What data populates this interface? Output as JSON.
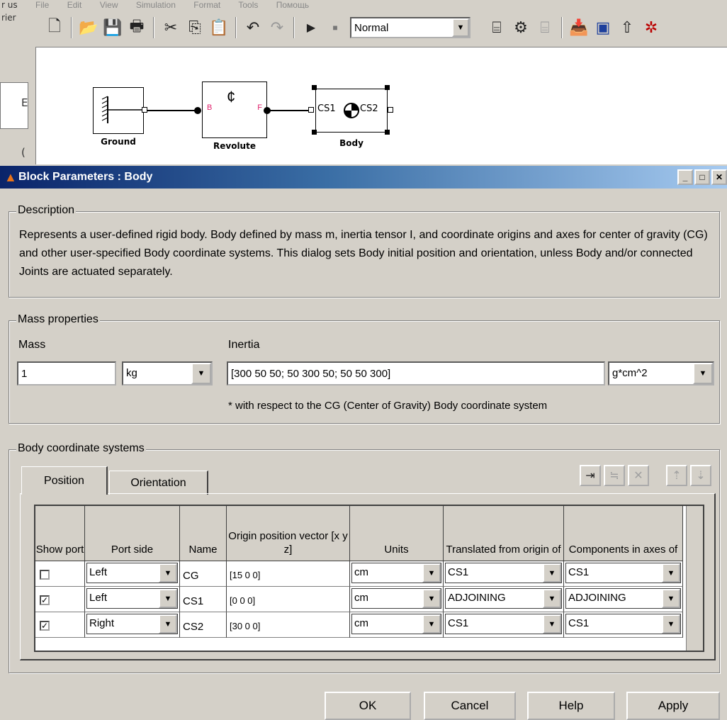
{
  "simulink": {
    "menu": [
      "File",
      "Edit",
      "View",
      "Simulation",
      "Format",
      "Tools",
      "Помощь"
    ],
    "left_fragments": [
      "r us",
      "rier",
      "E",
      "("
    ],
    "mode": "Normal",
    "blocks": {
      "ground": "Ground",
      "revolute": "Revolute",
      "revolute_b": "B",
      "revolute_f": "F",
      "body": "Body",
      "body_cs1": "CS1",
      "body_cs2": "CS2"
    }
  },
  "dialog": {
    "title": "Block Parameters : Body",
    "description": {
      "legend": "Description",
      "text": "Represents a user-defined rigid body. Body defined by mass m, inertia tensor I, and coordinate origins and axes for center of gravity (CG) and other user-specified Body coordinate systems. This dialog sets Body initial position and orientation, unless Body and/or connected Joints are actuated separately."
    },
    "mass_properties": {
      "legend": "Mass properties",
      "mass_label": "Mass",
      "mass_value": "1",
      "mass_unit": "kg",
      "inertia_label": "Inertia",
      "inertia_value": "[300 50 50; 50 300 50; 50 50 300]",
      "inertia_unit": "g*cm^2",
      "note": "* with respect to the CG (Center of Gravity) Body coordinate system"
    },
    "coord_systems": {
      "legend": "Body coordinate systems",
      "tabs": [
        "Position",
        "Orientation"
      ],
      "columns": [
        "Show port",
        "Port side",
        "Name",
        "Origin position vector [x y z]",
        "Units",
        "Translated from origin of",
        "Components in axes of"
      ],
      "rows": [
        {
          "show": "",
          "side": "Left",
          "name": "CG",
          "origin": "[15 0 0]",
          "units": "cm",
          "from": "CS1",
          "axes": "CS1"
        },
        {
          "show": "✓",
          "side": "Left",
          "name": "CS1",
          "origin": "[0 0 0]",
          "units": "cm",
          "from": "ADJOINING",
          "axes": "ADJOINING"
        },
        {
          "show": "✓",
          "side": "Right",
          "name": "CS2",
          "origin": "[30 0 0]",
          "units": "cm",
          "from": "CS1",
          "axes": "CS1"
        }
      ]
    },
    "buttons": {
      "ok": "OK",
      "cancel": "Cancel",
      "help": "Help",
      "apply": "Apply"
    }
  }
}
